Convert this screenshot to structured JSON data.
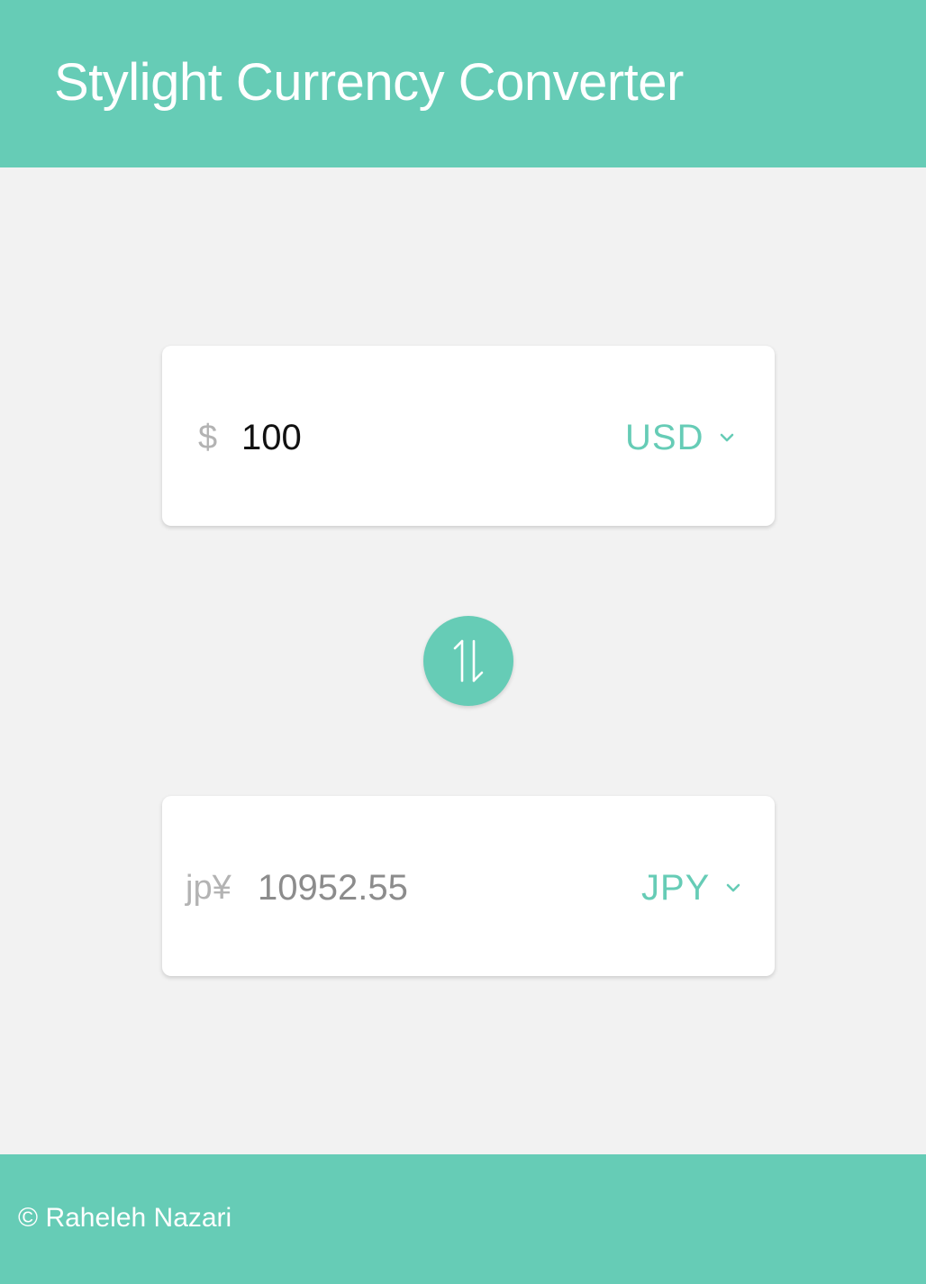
{
  "header": {
    "title": "Stylight Currency Converter"
  },
  "converter": {
    "from": {
      "symbol": "$",
      "amount": "100",
      "currency": "USD"
    },
    "to": {
      "symbol": "jp¥",
      "amount": "10952.55",
      "currency": "JPY"
    },
    "swap_icon": "swap-vertical-arrows-icon"
  },
  "footer": {
    "copyright": "© Raheleh Nazari"
  },
  "colors": {
    "accent": "#66ccb6",
    "background": "#f2f2f2",
    "card": "#ffffff",
    "muted_text": "#b3b3b3"
  }
}
